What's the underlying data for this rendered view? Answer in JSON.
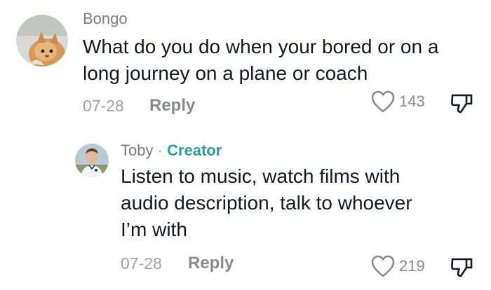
{
  "comments": [
    {
      "username": "Bongo",
      "text_lines": [
        "What do you do when your bored or on a",
        "long journey on a plane or coach"
      ],
      "date": "07-28",
      "reply_label": "Reply",
      "likes": "143",
      "avatar_icon": "cat-avatar-icon"
    },
    {
      "username": "Toby",
      "separator": "·",
      "badge": "Creator",
      "text_lines": [
        "Listen to music, watch films with",
        "audio description, talk to whoever",
        "I’m with"
      ],
      "date": "07-28",
      "reply_label": "Reply",
      "likes": "219",
      "avatar_icon": "person-avatar-icon"
    }
  ],
  "colors": {
    "creator_badge": "#2a9d9d",
    "muted_text": "#8a8b90",
    "primary_text": "#161823"
  }
}
